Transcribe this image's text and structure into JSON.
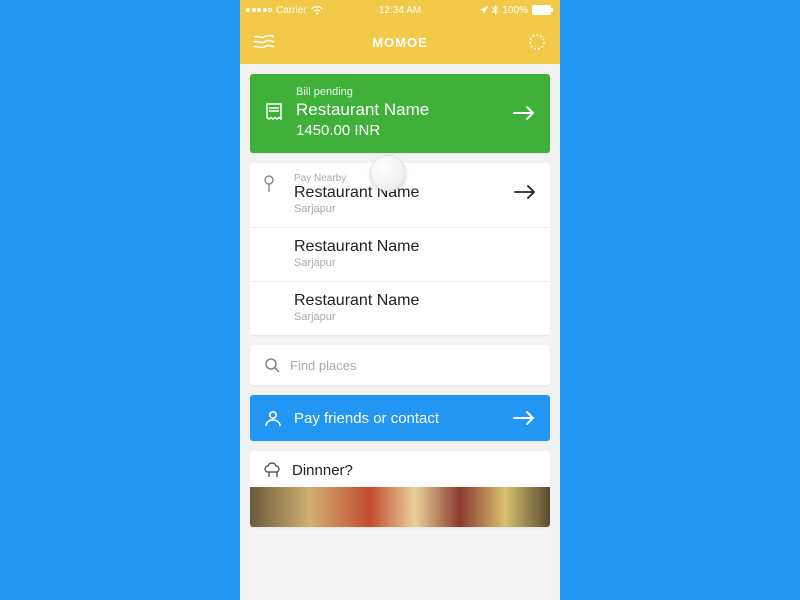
{
  "status": {
    "carrier": "Carrier",
    "time": "12:34 AM",
    "battery": "100%"
  },
  "nav": {
    "title": "MOMOE"
  },
  "bill": {
    "label": "Bill pending",
    "name": "Restaurant Name",
    "amount": "1450.00 INR"
  },
  "nearby": {
    "label": "Pay Nearby",
    "items": [
      {
        "name": "Restaurant Name",
        "sub": "Sarjapur"
      },
      {
        "name": "Restaurant Name",
        "sub": "Sarjapur"
      },
      {
        "name": "Restaurant Name",
        "sub": "Sarjapur"
      }
    ]
  },
  "search": {
    "placeholder": "Find places"
  },
  "friends": {
    "label": "Pay friends or contact"
  },
  "dinner": {
    "label": "Dinnner?"
  },
  "colors": {
    "accent_yellow": "#f3c94a",
    "accent_green": "#3fb03a",
    "accent_blue": "#2196f3"
  }
}
